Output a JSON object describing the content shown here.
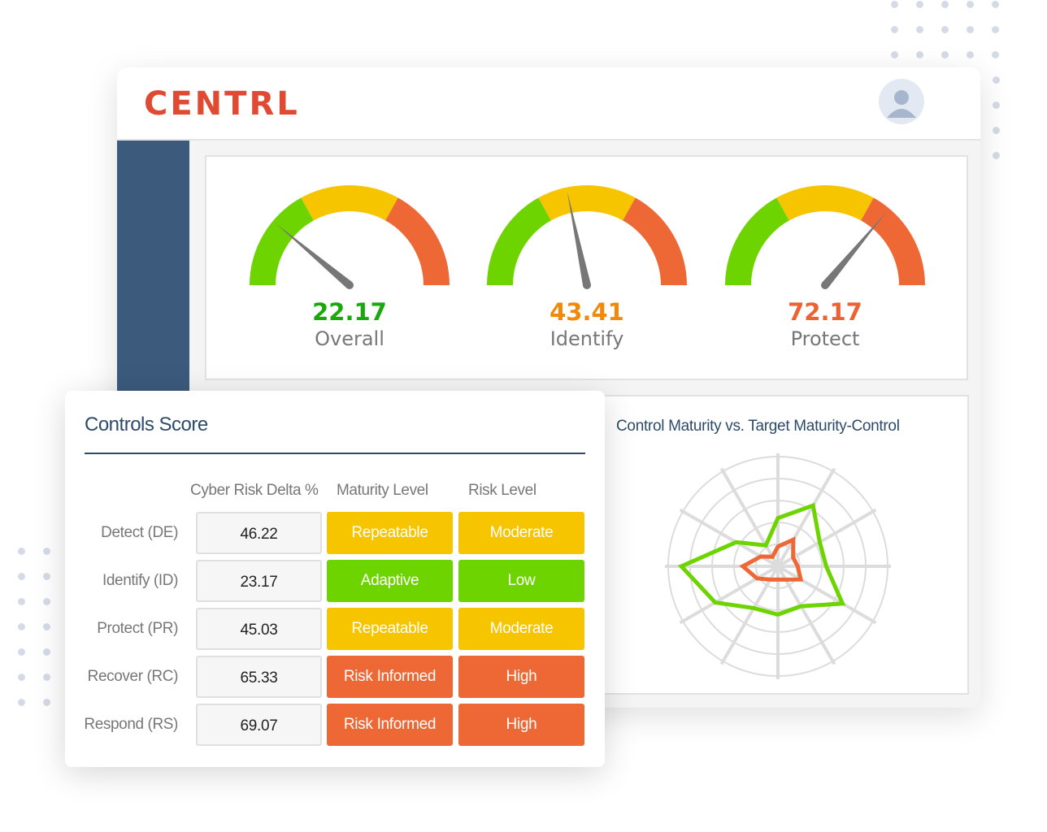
{
  "brand": {
    "logo": "CENTRL",
    "logo_color": "#e04a32",
    "sidebar_color": "#3b5a7c"
  },
  "header": {
    "avatar_icon": "user-avatar-icon"
  },
  "gauges": [
    {
      "value": "22.17",
      "percent": 22.17,
      "label": "Overall",
      "color": "#1aa80e"
    },
    {
      "value": "43.41",
      "percent": 43.41,
      "label": "Identify",
      "color": "#f08a0c"
    },
    {
      "value": "72.17",
      "percent": 72.17,
      "label": "Protect",
      "color": "#ec6233"
    }
  ],
  "gauge_colors": {
    "low": "#6dd400",
    "mid": "#f7c400",
    "high": "#ee6836",
    "needle": "#777777"
  },
  "radar": {
    "title": "Control Maturity vs. Target Maturity-Control",
    "chart_data": {
      "type": "radar",
      "axes_count": 12,
      "rings": 5,
      "range": [
        0,
        5
      ],
      "series": [
        {
          "color": "#6dd400",
          "values": [
            2.2,
            3.2,
            2.2,
            2.2,
            3.4,
            2.1,
            2.2,
            2.2,
            3.3,
            4.4,
            2.2,
            1.1
          ]
        },
        {
          "color": "#ee6836",
          "values": [
            0.9,
            1.4,
            0.8,
            0.9,
            1.2,
            0.7,
            0.6,
            0.7,
            1.1,
            1.6,
            0.9,
            0.5
          ]
        }
      ]
    }
  },
  "controls": {
    "title": "Controls Score",
    "columns": [
      "Cyber Risk Delta %",
      "Maturity Level",
      "Risk Level"
    ],
    "rows": [
      {
        "name": "Detect (DE)",
        "delta": "46.22",
        "maturity": "Repeatable",
        "maturity_color": "#f7c400",
        "risk": "Moderate",
        "risk_color": "#f7c400"
      },
      {
        "name": "Identify (ID)",
        "delta": "23.17",
        "maturity": "Adaptive",
        "maturity_color": "#6dd400",
        "risk": "Low",
        "risk_color": "#6dd400"
      },
      {
        "name": "Protect (PR)",
        "delta": "45.03",
        "maturity": "Repeatable",
        "maturity_color": "#f7c400",
        "risk": "Moderate",
        "risk_color": "#f7c400"
      },
      {
        "name": "Recover (RC)",
        "delta": "65.33",
        "maturity": "Risk Informed",
        "maturity_color": "#ee6836",
        "risk": "High",
        "risk_color": "#ee6836"
      },
      {
        "name": "Respond (RS)",
        "delta": "69.07",
        "maturity": "Risk Informed",
        "maturity_color": "#ee6836",
        "risk": "High",
        "risk_color": "#ee6836"
      }
    ]
  }
}
